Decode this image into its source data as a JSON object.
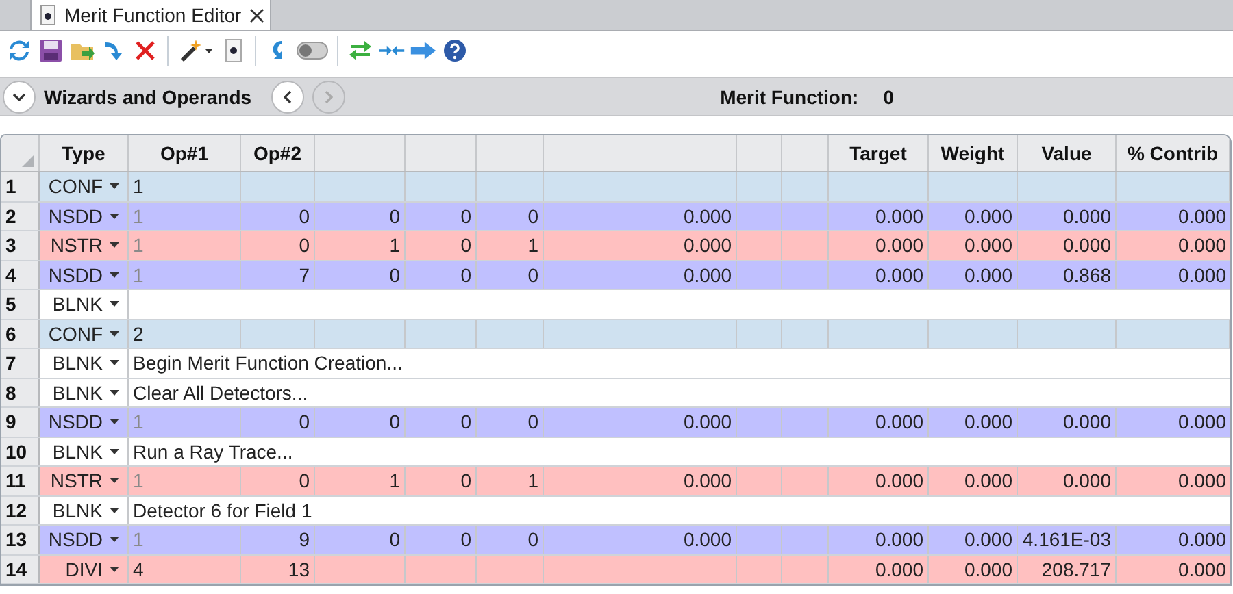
{
  "tab": {
    "title": "Merit Function Editor"
  },
  "toolbar": {
    "toggle_on": false
  },
  "wizards_bar": {
    "title": "Wizards and Operands",
    "back_disabled": false,
    "forward_disabled": true,
    "merit_label": "Merit Function:",
    "merit_value": "0"
  },
  "table": {
    "columns": [
      "Type",
      "Op#1",
      "Op#2",
      null,
      null,
      null,
      null,
      null,
      null,
      "Target",
      "Weight",
      "Value",
      "% Contrib"
    ],
    "rows": [
      {
        "number": "1",
        "type": "CONF",
        "kind": "operand",
        "color": "#cfe1f0",
        "op1": "1",
        "op1_greyed": false
      },
      {
        "number": "2",
        "type": "NSDD",
        "kind": "operand",
        "color": "#c0c0ff",
        "op1": "1",
        "op1_greyed": true,
        "cells": {
          "op2": "0",
          "column_4": "0",
          "column_5": "0",
          "column_6": "0",
          "column_7": "0.000",
          "target": "0.000",
          "weight": "0.000",
          "value": "0.000",
          "contrib": "0.000"
        }
      },
      {
        "number": "3",
        "type": "NSTR",
        "kind": "operand",
        "color": "#ffc0c0",
        "op1": "1",
        "op1_greyed": true,
        "cells": {
          "op2": "0",
          "column_4": "1",
          "column_5": "0",
          "column_6": "1",
          "column_7": "0.000",
          "target": "0.000",
          "weight": "0.000",
          "value": "0.000",
          "contrib": "0.000"
        }
      },
      {
        "number": "4",
        "type": "NSDD",
        "kind": "operand",
        "color": "#c0c0ff",
        "op1": "1",
        "op1_greyed": true,
        "cells": {
          "op2": "7",
          "column_4": "0",
          "column_5": "0",
          "column_6": "0",
          "column_7": "0.000",
          "target": "0.000",
          "weight": "0.000",
          "value": "0.868",
          "contrib": "0.000"
        }
      },
      {
        "number": "5",
        "type": "BLNK",
        "kind": "comment",
        "color": "#ffffff"
      },
      {
        "number": "6",
        "type": "CONF",
        "kind": "operand",
        "color": "#cfe1f0",
        "op1": "2",
        "op1_greyed": false
      },
      {
        "number": "7",
        "type": "BLNK",
        "kind": "comment",
        "color": "#ffffff",
        "comment": "Begin Merit Function Creation..."
      },
      {
        "number": "8",
        "type": "BLNK",
        "kind": "comment",
        "color": "#ffffff",
        "comment": "Clear All Detectors..."
      },
      {
        "number": "9",
        "type": "NSDD",
        "kind": "operand",
        "color": "#c0c0ff",
        "op1": "1",
        "op1_greyed": true,
        "cells": {
          "op2": "0",
          "column_4": "0",
          "column_5": "0",
          "column_6": "0",
          "column_7": "0.000",
          "target": "0.000",
          "weight": "0.000",
          "value": "0.000",
          "contrib": "0.000"
        }
      },
      {
        "number": "10",
        "type": "BLNK",
        "kind": "comment",
        "color": "#ffffff",
        "comment": "Run a Ray Trace..."
      },
      {
        "number": "11",
        "type": "NSTR",
        "kind": "operand",
        "color": "#ffc0c0",
        "op1": "1",
        "op1_greyed": true,
        "cells": {
          "op2": "0",
          "column_4": "1",
          "column_5": "0",
          "column_6": "1",
          "column_7": "0.000",
          "target": "0.000",
          "weight": "0.000",
          "value": "0.000",
          "contrib": "0.000"
        }
      },
      {
        "number": "12",
        "type": "BLNK",
        "kind": "comment",
        "color": "#ffffff",
        "comment": "Detector 6 for Field 1"
      },
      {
        "number": "13",
        "type": "NSDD",
        "kind": "operand",
        "color": "#c0c0ff",
        "op1": "1",
        "op1_greyed": true,
        "cells": {
          "op2": "9",
          "column_4": "0",
          "column_5": "0",
          "column_6": "0",
          "column_7": "0.000",
          "target": "0.000",
          "weight": "0.000",
          "value": "4.161E-03",
          "contrib": "0.000"
        }
      },
      {
        "number": "14",
        "type": "DIVI",
        "kind": "operand",
        "color": "#ffc0c0",
        "op1": "4",
        "op1_greyed": false,
        "cells": {
          "op2": "13",
          "target": "0.000",
          "weight": "0.000",
          "value": "208.717",
          "contrib": "0.000"
        }
      }
    ]
  }
}
